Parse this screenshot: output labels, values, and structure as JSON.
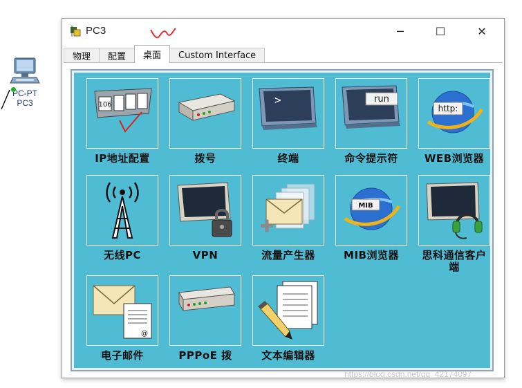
{
  "workspace": {
    "device_type": "PC-PT",
    "device_name": "PC3"
  },
  "window": {
    "title": "PC3",
    "controls": {
      "minimize": "─",
      "maximize": "☐",
      "close": "✕"
    },
    "tabs": [
      {
        "label": "物理",
        "active": false
      },
      {
        "label": "配置",
        "active": false
      },
      {
        "label": "桌面",
        "active": true
      },
      {
        "label": "Custom Interface",
        "active": false
      }
    ]
  },
  "desktop": {
    "background_color": "#4fbcd4",
    "apps": [
      {
        "label": "IP地址配置",
        "icon": "ip-config-icon"
      },
      {
        "label": "拨号",
        "icon": "dialup-modem-icon"
      },
      {
        "label": "终端",
        "icon": "terminal-icon"
      },
      {
        "label": "命令提示符",
        "icon": "command-prompt-icon",
        "icon_text": "run"
      },
      {
        "label": "WEB浏览器",
        "icon": "web-browser-icon",
        "icon_text": "http:"
      },
      {
        "label": "无线PC",
        "icon": "wireless-tower-icon"
      },
      {
        "label": "VPN",
        "icon": "vpn-lock-icon"
      },
      {
        "label": "流量产生器",
        "icon": "traffic-generator-icon"
      },
      {
        "label": "MIB浏览器",
        "icon": "mib-browser-icon",
        "icon_text": "MIB"
      },
      {
        "label": "思科通信客户端",
        "icon": "ip-communicator-icon"
      },
      {
        "label": "电子邮件",
        "icon": "email-icon"
      },
      {
        "label": "PPPoE 拨",
        "icon": "pppoe-dialer-icon"
      },
      {
        "label": "文本编辑器",
        "icon": "text-editor-icon"
      }
    ],
    "ip_config_icon_text": "106"
  },
  "watermark": "https://blog.csdn.net/qq_42174097"
}
